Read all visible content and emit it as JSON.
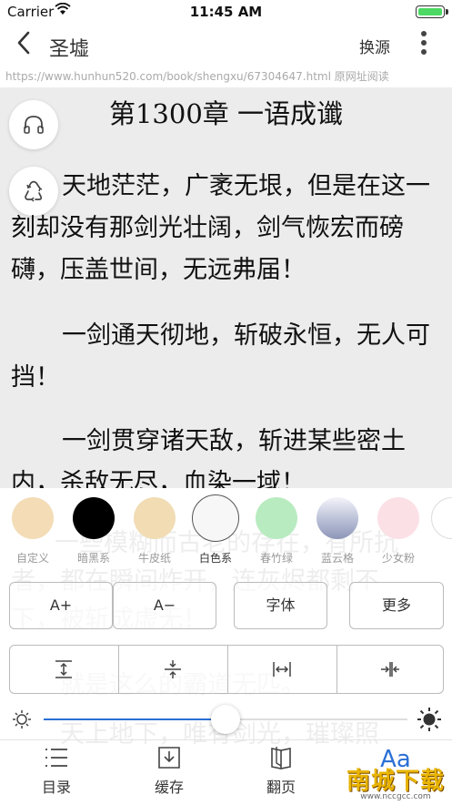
{
  "status": {
    "carrier": "Carrier",
    "time": "11:45 AM"
  },
  "nav": {
    "title": "圣墟",
    "source_label": "换源"
  },
  "url_text": "https://www.hunhun520.com/book/shengxu/67304647.html 原网址阅读",
  "chapter": {
    "title": "第1300章 一语成谶",
    "paragraphs": [
      "天地茫茫，广袤无垠，但是在这一刻却没有那剑光壮阔，剑气恢宏而磅礴，压盖世间，无远弗届！",
      "一剑通天彻地，斩破永恒，无人可挡！",
      "一剑贯穿诸天敌，斩进某些密土内，杀敌无尽，血染一域！"
    ],
    "ghost_lines": [
      "一些模糊而古老的存在，有所抗",
      "者，都在瞬间炸开，连灰烬都剩不",
      "下，被斩成虚无！",
      "　　就是这么的霸道无匹。",
      "　　天上地下，唯有剑光，璀璨照"
    ]
  },
  "themes": [
    {
      "label": "自定义",
      "color": "#f3dcb6"
    },
    {
      "label": "暗黑系",
      "color": "#000000"
    },
    {
      "label": "牛皮纸",
      "color": "#f1dcb4"
    },
    {
      "label": "白色系",
      "color": "#f7f7f7"
    },
    {
      "label": "春竹绿",
      "color": "#b8ebc0"
    },
    {
      "label": "蓝云格",
      "color": "#b8bfd6"
    },
    {
      "label": "少女粉",
      "color": "#fbe0e6"
    },
    {
      "label": "",
      "color": "#ffffff"
    }
  ],
  "selected_theme": "白色系",
  "font_buttons": {
    "increase": "A+",
    "decrease": "A−",
    "font": "字体",
    "more": "更多"
  },
  "brightness": 0.5,
  "tabs": {
    "catalog": "目录",
    "cache": "缓存",
    "page_turn": "翻页",
    "settings": "Aa"
  },
  "watermark": {
    "main": "南城下载",
    "sub": "www.nccgcc.com"
  },
  "colors": {
    "accent": "#2b6fd6",
    "reader_bg": "#ececec"
  }
}
